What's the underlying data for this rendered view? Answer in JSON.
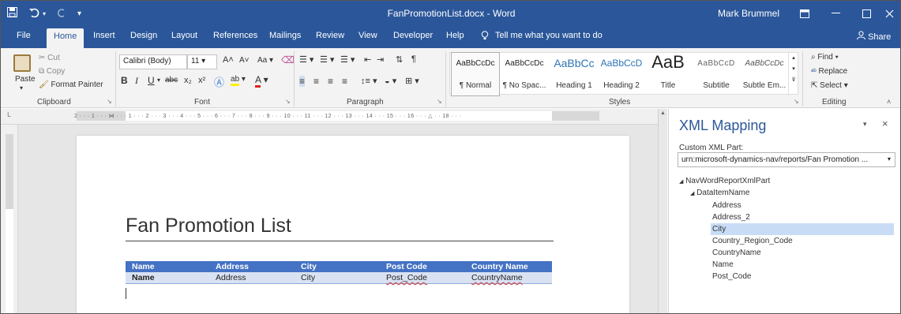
{
  "title_bar": {
    "document_title": "FanPromotionList.docx - Word",
    "user_name": "Mark Brummel",
    "icons": [
      "save-icon",
      "undo-icon",
      "redo-icon",
      "customize-qat-icon",
      "ribbon-display-options-icon",
      "minimize-icon",
      "maximize-icon",
      "close-icon"
    ]
  },
  "tabs": {
    "file": "File",
    "home": "Home",
    "insert": "Insert",
    "design": "Design",
    "layout": "Layout",
    "references": "References",
    "mailings": "Mailings",
    "review": "Review",
    "view": "View",
    "developer": "Developer",
    "help": "Help",
    "tell_me": "Tell me what you want to do",
    "share": "Share"
  },
  "clipboard": {
    "paste": "Paste",
    "cut": "Cut",
    "copy": "Copy",
    "format_painter": "Format Painter",
    "label": "Clipboard"
  },
  "font": {
    "font_name": "Calibri (Body)",
    "font_size": "11",
    "label": "Font"
  },
  "paragraph": {
    "label": "Paragraph"
  },
  "styles": {
    "label": "Styles",
    "items": [
      {
        "preview": "AaBbCcDc",
        "name": "¶ Normal"
      },
      {
        "preview": "AaBbCcDc",
        "name": "¶ No Spac..."
      },
      {
        "preview": "AaBbCc",
        "name": "Heading 1"
      },
      {
        "preview": "AaBbCcD",
        "name": "Heading 2"
      },
      {
        "preview": "AaB",
        "name": "Title"
      },
      {
        "preview": "AaBbCcD",
        "name": "Subtitle"
      },
      {
        "preview": "AaBbCcDc",
        "name": "Subtle Em..."
      }
    ]
  },
  "editing": {
    "find": "Find",
    "replace": "Replace",
    "select": "Select",
    "label": "Editing"
  },
  "document": {
    "heading": "Fan Promotion List",
    "table": {
      "headers": [
        "Name",
        "Address",
        "City",
        "Post Code",
        "Country Name"
      ],
      "row": [
        "Name",
        "Address",
        "City",
        "Post_Code",
        "CountryName"
      ]
    }
  },
  "xml_mapping": {
    "title": "XML Mapping",
    "custom_part_label": "Custom XML Part:",
    "custom_part_value": "urn:microsoft-dynamics-nav/reports/Fan Promotion ...",
    "root": "NavWordReportXmlPart",
    "node": "DataItemName",
    "fields": [
      "Address",
      "Address_2",
      "City",
      "Country_Region_Code",
      "CountryName",
      "Name",
      "Post_Code"
    ],
    "selected_field": "City"
  }
}
